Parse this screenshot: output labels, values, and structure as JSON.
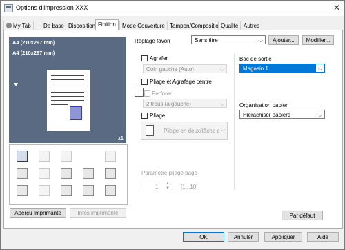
{
  "window": {
    "title": "Options d'impression XXX",
    "close_glyph": "✕"
  },
  "tabs": [
    "My Tab",
    "De base",
    "Disposition",
    "Finition",
    "Mode Couverture",
    "Tampon/Composition",
    "Qualité",
    "Autres"
  ],
  "preview": {
    "paper_top": "A4 (210x297 mm)",
    "paper_bottom": "A4 (210x297 mm)",
    "copies": "x1"
  },
  "left_buttons": {
    "printer_view": "Aperçu Imprimante",
    "printer_info": "Infos imprimante"
  },
  "favorite": {
    "label": "Réglage favori",
    "value": "Sans titre",
    "add": "Ajouter...",
    "modify": "Modifier..."
  },
  "finishing": {
    "staple_label": "Agrafer",
    "staple_value": "Coin gauche (Auto)",
    "saddle_stitch_label": "Pliage et Agrafage centre",
    "punch_label": "Perforer",
    "punch_value": "2 trous (à gauche)",
    "fold_label": "Pliage",
    "fold_value": "Pliage en deux(tâche c",
    "fold_param_label": "Paramètre pliage page",
    "fold_param_value": "1",
    "fold_param_range": "[1...10]"
  },
  "output": {
    "tray_label": "Bac de sortie",
    "tray_value": "Magasin 1",
    "paper_org_label": "Organisation papier",
    "paper_org_value": "Hiérachiser papiers"
  },
  "default_button": "Par défaut",
  "bottom_buttons": {
    "ok": "OK",
    "cancel": "Annuler",
    "apply": "Appliquer",
    "help": "Aide"
  },
  "colors": {
    "preview_bg": "#5a6a82",
    "accent": "#0078d7",
    "tab_active_bg": "#ffffff"
  }
}
